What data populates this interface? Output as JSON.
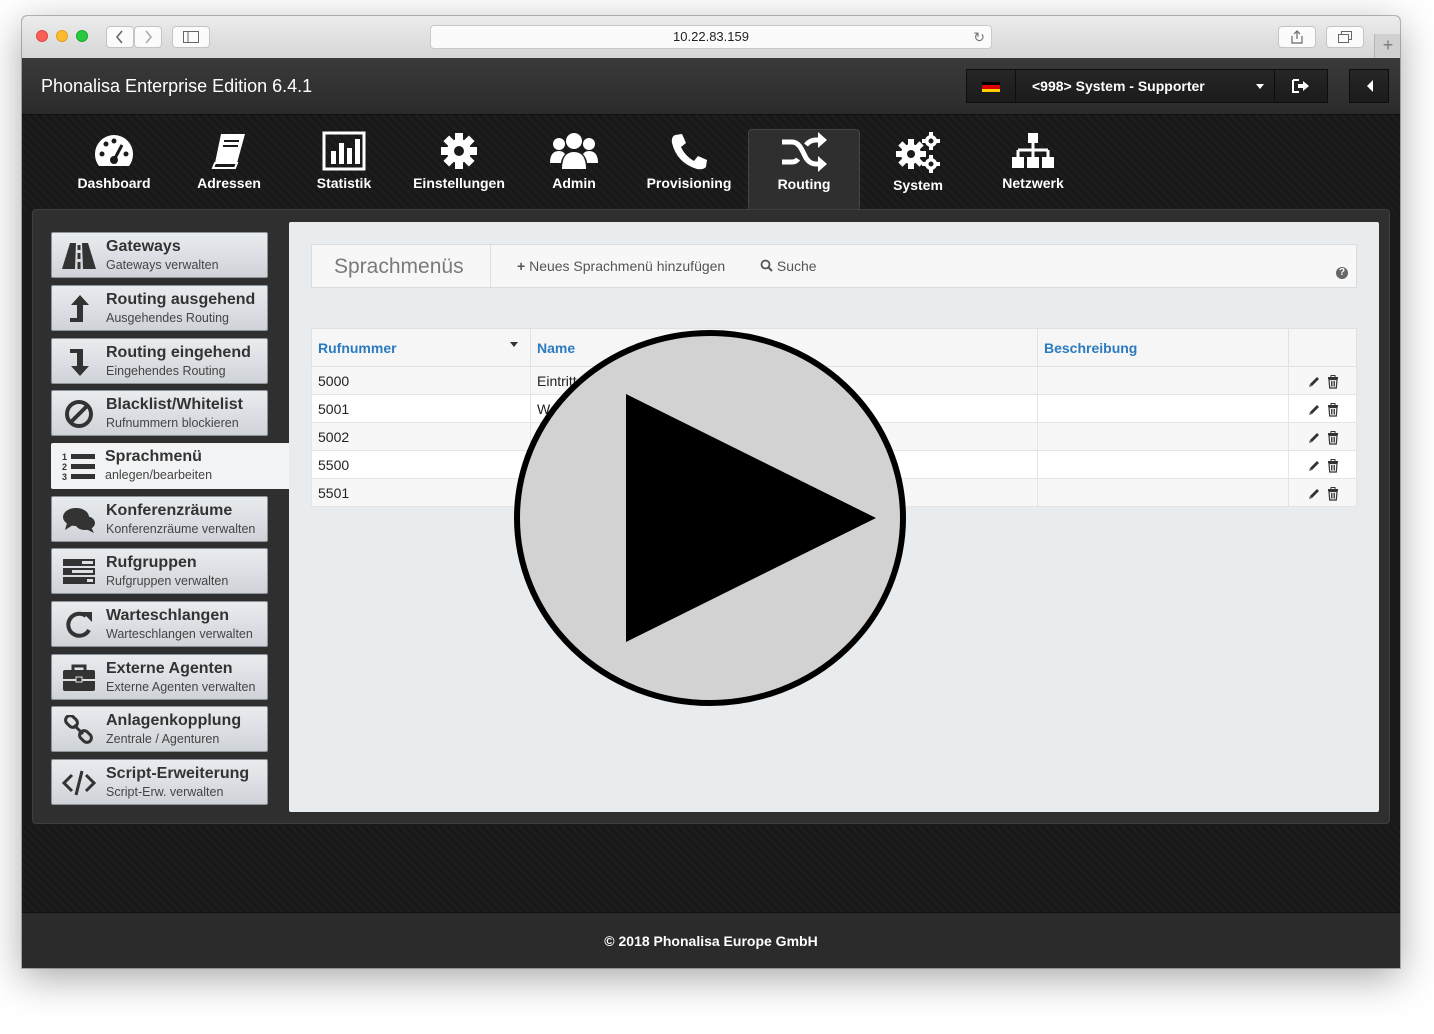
{
  "browser": {
    "url": "10.22.83.159"
  },
  "app": {
    "title": "Phonalisa Enterprise Edition 6.4.1",
    "user_selector": "<998> System - Supporter",
    "footer": "© 2018 Phonalisa Europe GmbH"
  },
  "topnav": [
    {
      "label": "Dashboard",
      "icon": "dashboard-icon"
    },
    {
      "label": "Adressen",
      "icon": "book-icon"
    },
    {
      "label": "Statistik",
      "icon": "bar-chart-icon"
    },
    {
      "label": "Einstellungen",
      "icon": "gear-icon"
    },
    {
      "label": "Admin",
      "icon": "users-icon"
    },
    {
      "label": "Provisioning",
      "icon": "phone-icon"
    },
    {
      "label": "Routing",
      "icon": "shuffle-icon",
      "active": true
    },
    {
      "label": "System",
      "icon": "gears-icon"
    },
    {
      "label": "Netzwerk",
      "icon": "sitemap-icon"
    }
  ],
  "sidebar": [
    {
      "title": "Gateways",
      "sub": "Gateways verwalten",
      "icon": "road-icon"
    },
    {
      "title": "Routing ausgehend",
      "sub": "Ausgehendes Routing",
      "icon": "arrow-up-icon"
    },
    {
      "title": "Routing eingehend",
      "sub": "Eingehendes Routing",
      "icon": "arrow-down-icon"
    },
    {
      "title": "Blacklist/Whitelist",
      "sub": "Rufnummern blockieren",
      "icon": "ban-icon"
    },
    {
      "title": "Sprachmenü",
      "sub": "anlegen/bearbeiten",
      "icon": "ordered-list-icon",
      "active": true
    },
    {
      "title": "Konferenzräume",
      "sub": "Konferenzräume verwalten",
      "icon": "comments-icon"
    },
    {
      "title": "Rufgruppen",
      "sub": "Rufgruppen verwalten",
      "icon": "tasks-icon"
    },
    {
      "title": "Warteschlangen",
      "sub": "Warteschlangen verwalten",
      "icon": "refresh-icon"
    },
    {
      "title": "Externe Agenten",
      "sub": "Externe Agenten verwalten",
      "icon": "briefcase-icon"
    },
    {
      "title": "Anlagenkopplung",
      "sub": "Zentrale / Agenturen",
      "icon": "link-icon"
    },
    {
      "title": "Script-Erweiterung",
      "sub": "Script-Erw. verwalten",
      "icon": "code-icon"
    }
  ],
  "panel": {
    "title": "Sprachmenüs",
    "add_label": "Neues Sprachmenü hinzufügen",
    "search_label": "Suche",
    "help": "?",
    "columns": [
      "Rufnummer",
      "Name",
      "Beschreibung",
      ""
    ],
    "rows": [
      {
        "number": "5000",
        "name": "Eintritt",
        "desc": ""
      },
      {
        "number": "5001",
        "name": "We",
        "desc": ""
      },
      {
        "number": "5002",
        "name": "",
        "desc": ""
      },
      {
        "number": "5500",
        "name": "",
        "desc": ""
      },
      {
        "number": "5501",
        "name": "",
        "desc": ""
      }
    ]
  },
  "colors": {
    "accent_link": "#2a7bc0",
    "header_bg": "#2b2b2b",
    "panel_bg": "#e9ecef"
  }
}
